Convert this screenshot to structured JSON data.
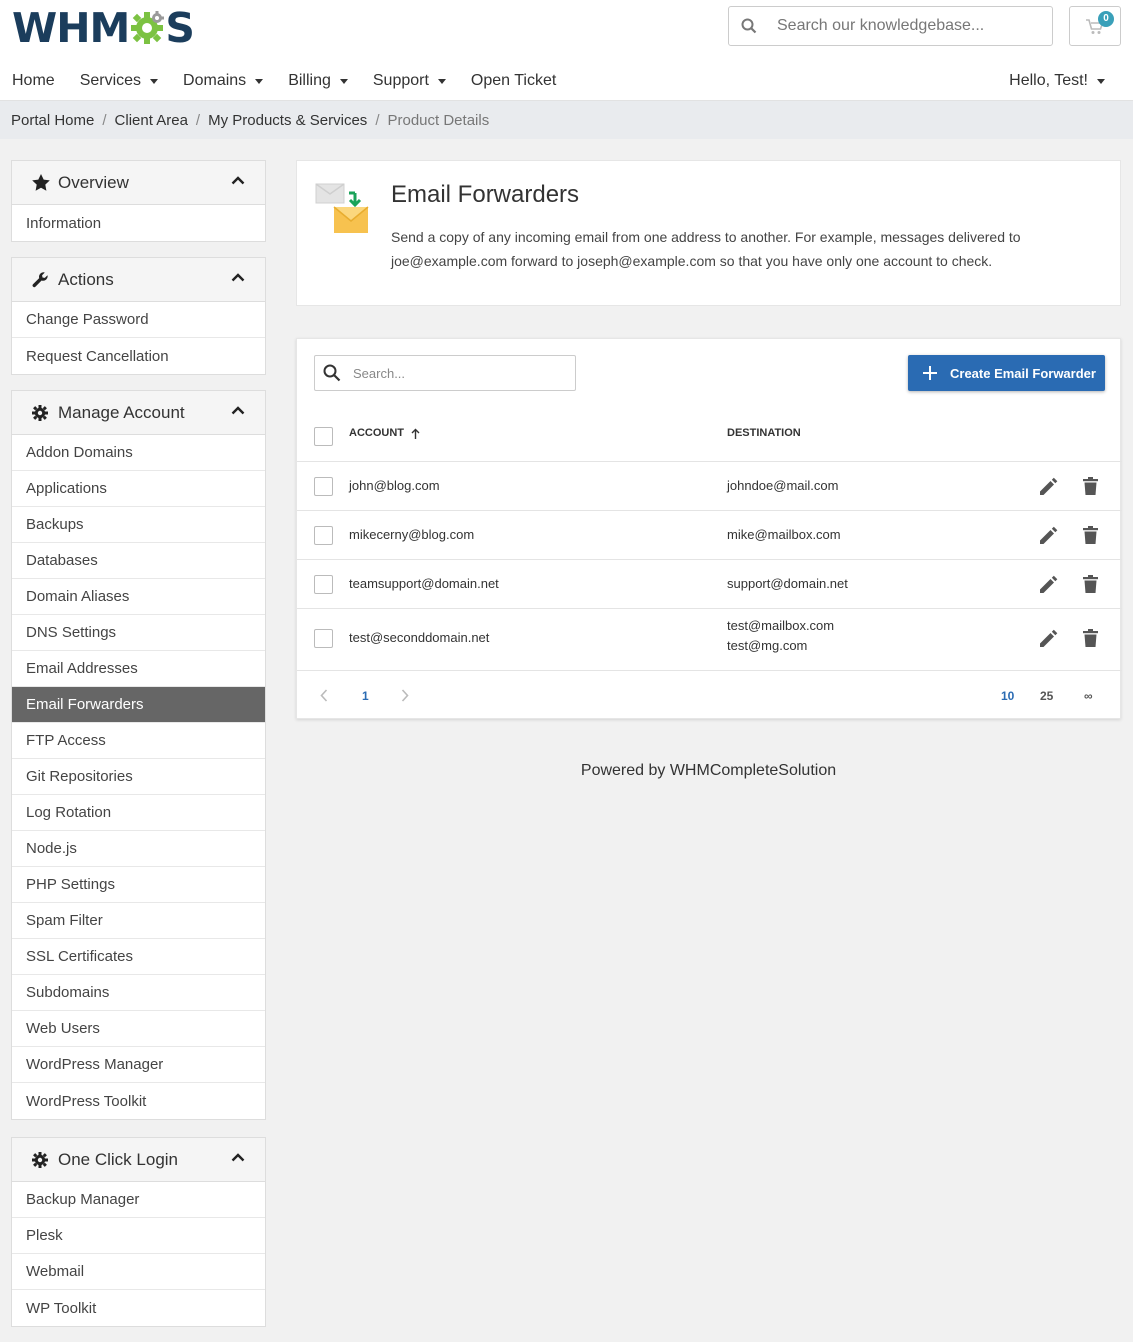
{
  "brand": {
    "logo_left": "WHM",
    "logo_right": "S"
  },
  "header": {
    "search_placeholder": "Search our knowledgebase...",
    "cart_count": "0",
    "nav": [
      {
        "label": "Home"
      },
      {
        "label": "Services"
      },
      {
        "label": "Domains"
      },
      {
        "label": "Billing"
      },
      {
        "label": "Support"
      },
      {
        "label": "Open Ticket"
      }
    ],
    "user_menu": "Hello, Test!"
  },
  "breadcrumb": {
    "items": [
      "Portal Home",
      "Client Area",
      "My Products & Services"
    ],
    "current": "Product Details"
  },
  "sidebar": {
    "overview": {
      "title": "Overview",
      "items": [
        "Information"
      ]
    },
    "actions": {
      "title": "Actions",
      "items": [
        "Change Password",
        "Request Cancellation"
      ]
    },
    "manage": {
      "title": "Manage Account",
      "items": [
        "Addon Domains",
        "Applications",
        "Backups",
        "Databases",
        "Domain Aliases",
        "DNS Settings",
        "Email Addresses",
        "Email Forwarders",
        "FTP Access",
        "Git Repositories",
        "Log Rotation",
        "Node.js",
        "PHP Settings",
        "Spam Filter",
        "SSL Certificates",
        "Subdomains",
        "Web Users",
        "WordPress Manager",
        "WordPress Toolkit"
      ],
      "active": "Email Forwarders"
    },
    "oneclick": {
      "title": "One Click Login",
      "items": [
        "Backup Manager",
        "Plesk",
        "Webmail",
        "WP Toolkit"
      ]
    }
  },
  "intro": {
    "title": "Email Forwarders",
    "desc_line1": "Send a copy of any incoming email from one address to another. For example, messages delivered to",
    "desc_line2": "joe@example.com forward to joseph@example.com so that you have only one account to check."
  },
  "table": {
    "search_placeholder": "Search...",
    "create_label": "Create Email Forwarder",
    "col_account": "ACCOUNT",
    "col_destination": "DESTINATION",
    "rows": [
      {
        "account": "john@blog.com",
        "destinations": [
          "johndoe@mail.com"
        ]
      },
      {
        "account": "mikecerny@blog.com",
        "destinations": [
          "mike@mailbox.com"
        ]
      },
      {
        "account": "teamsupport@domain.net",
        "destinations": [
          "support@domain.net"
        ]
      },
      {
        "account": "test@seconddomain.net",
        "destinations": [
          "test@mailbox.com",
          "test@mg.com"
        ]
      }
    ],
    "pagination": {
      "current_page": "1",
      "sizes": [
        "10",
        "25",
        "∞"
      ],
      "selected_size": "10"
    }
  },
  "footer": {
    "text": "Powered by WHMCompleteSolution"
  },
  "colors": {
    "primary": "#2a6bb3",
    "brand_dark": "#1b3d5c",
    "brand_green": "#7cc242",
    "active_item": "#666666",
    "badge": "#3aa0b9"
  }
}
